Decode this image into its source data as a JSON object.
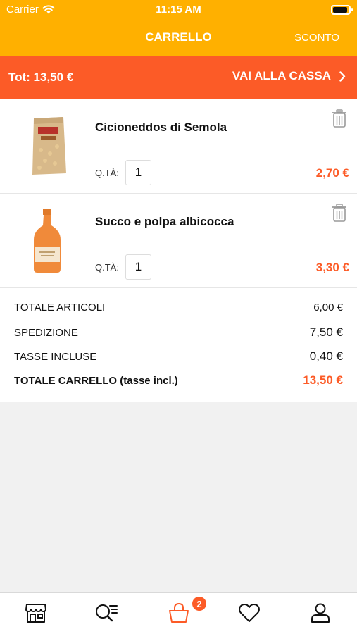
{
  "status_bar": {
    "carrier": "Carrier",
    "time": "11:15 AM"
  },
  "nav": {
    "title": "CARRELLO",
    "discount": "SCONTO"
  },
  "checkout": {
    "total": "Tot: 13,50 €",
    "button": "VAI ALLA CASSA"
  },
  "cart": {
    "qty_label": "Q.TÀ:",
    "items": [
      {
        "name": "Cicioneddos di Semola",
        "qty": "1",
        "price": "2,70 €"
      },
      {
        "name": "Succo e polpa albicocca",
        "qty": "1",
        "price": "3,30 €"
      }
    ]
  },
  "summary": {
    "articles_label": "TOTALE ARTICOLI",
    "articles_value": "6,00 €",
    "shipping_label": "SPEDIZIONE",
    "shipping_value": "7,50 €",
    "tax_label": "TASSE INCLUSE",
    "tax_value": "0,40 €",
    "total_label": "TOTALE CARRELLO (tasse incl.)",
    "total_value": "13,50 €"
  },
  "tabbar": {
    "tabs": [
      {
        "icon": "store-icon"
      },
      {
        "icon": "search-list-icon"
      },
      {
        "icon": "shopping-bag-icon"
      },
      {
        "icon": "heart-icon"
      },
      {
        "icon": "user-icon"
      }
    ],
    "cart_badge": "2"
  },
  "colors": {
    "header": "#ffb000",
    "accent": "#fc5b27",
    "background": "#f1f1f1"
  }
}
